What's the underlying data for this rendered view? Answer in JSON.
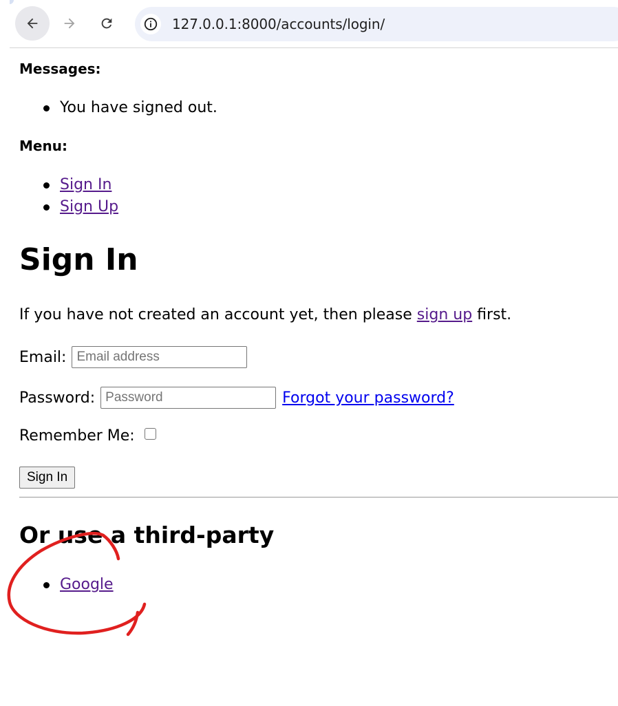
{
  "browser": {
    "url": "127.0.0.1:8000/accounts/login/",
    "back_icon": "back-arrow-icon",
    "forward_icon": "forward-arrow-icon",
    "reload_icon": "reload-icon",
    "site_info_icon": "info-icon"
  },
  "messages": {
    "heading": "Messages:",
    "items": [
      "You have signed out."
    ]
  },
  "menu": {
    "heading": "Menu:",
    "items": [
      "Sign In",
      "Sign Up"
    ]
  },
  "signin": {
    "title": "Sign In",
    "intro_before": "If you have not created an account yet, then please ",
    "intro_link": "sign up",
    "intro_after": " first.",
    "email_label": "Email:",
    "email_placeholder": "Email address",
    "password_label": "Password:",
    "password_placeholder": "Password",
    "forgot_link": "Forgot your password?",
    "remember_label": "Remember Me:",
    "remember_checked": false,
    "submit_label": "Sign In"
  },
  "third_party": {
    "heading": "Or use a third-party",
    "providers": [
      "Google"
    ]
  },
  "annotation": {
    "color": "#e0201f"
  }
}
